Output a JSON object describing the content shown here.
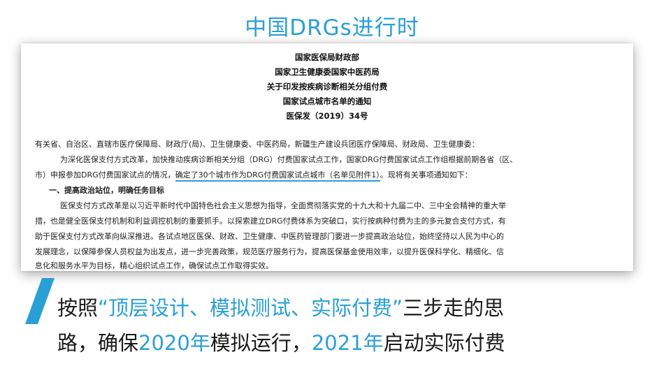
{
  "slide": {
    "title": "中国DRGs进行时"
  },
  "document": {
    "headings": [
      "国家医保局财政部",
      "国家卫生健康委国家中医药局",
      "关于印发按疾病诊断相关分组付费",
      "国家试点城市名单的通知",
      "医保发（2019）34号"
    ],
    "addressee": "有关省、自治区、直辖市医疗保障局、财政厅(局)、卫生健康委、中医药局，新疆生产建设兵团医疗保障局、财政局、卫生健康委：",
    "para1_line1": "为深化医保支付方式改革，加快推动疾病诊断相关分组（DRG）付费国家试点工作，国家DRG付费国家试点工作组根据前期各省（区、",
    "para1_line2_prefix": "市）申报参加DRG付费国家试点的情况，",
    "para1_line2_underlined": "确定了30个城市作为DRG付费国家试点城市（名单见附件1）",
    "para1_line2_suffix": "。现将有关事项通知如下：",
    "section1": "一、提高政治站位，明确任务目标",
    "para2_line1": "医保支付方式改革是以习近平新时代中国特色社会主义思想为指导，全面贯彻落实党的十九大和十九届二中、三中全会精神的重大举",
    "para2_line2": "措，也是健全医保支付机制和利益调控机制的重要抓手。以探索建立DRG付费体系为突破口，实行按病种付费为主的多元复合支付方式，有",
    "para2_line3": "助于医保支付方式改革向纵深推进。各试点地区医保、财政、卫生健康、中医药管理部门要进一步提高政治站位，始终坚持以人民为中心的",
    "para2_line4": "发展理念，以保障参保人员权益为出发点，进一步完善政策，规范医疗服务行为，提高医保基金使用效率，以提升医保科学化、精细化、信",
    "para2_line5": "息化和服务水平为目标，精心组织试点工作，确保试点工作取得实效。"
  },
  "caption": {
    "line1_a": "按照",
    "line1_b": "“顶层设计、模拟测试、实际付费”",
    "line1_c": "三步走的思",
    "line2_a": "路，确保",
    "line2_b": "2020年",
    "line2_c": "模拟运行，",
    "line2_d": "2021年",
    "line2_e": "启动实际付费"
  },
  "colors": {
    "accent": "#2a9fd6",
    "text": "#1a1a1a"
  }
}
